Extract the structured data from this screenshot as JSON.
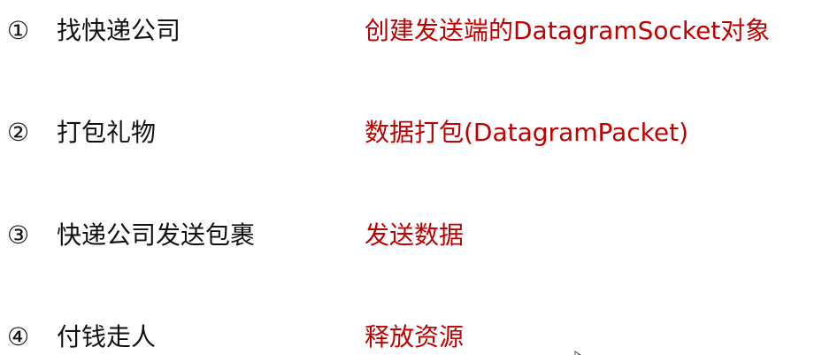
{
  "steps": [
    {
      "number": "①",
      "label": "找快递公司",
      "action": "创建发送端的DatagramSocket对象"
    },
    {
      "number": "②",
      "label": "打包礼物",
      "action": "数据打包(DatagramPacket)"
    },
    {
      "number": "③",
      "label": "快递公司发送包裹",
      "action": "发送数据"
    },
    {
      "number": "④",
      "label": "付钱走人",
      "action": "释放资源"
    }
  ],
  "colors": {
    "text": "#111111",
    "accent": "#c00000",
    "background": "#ffffff"
  }
}
